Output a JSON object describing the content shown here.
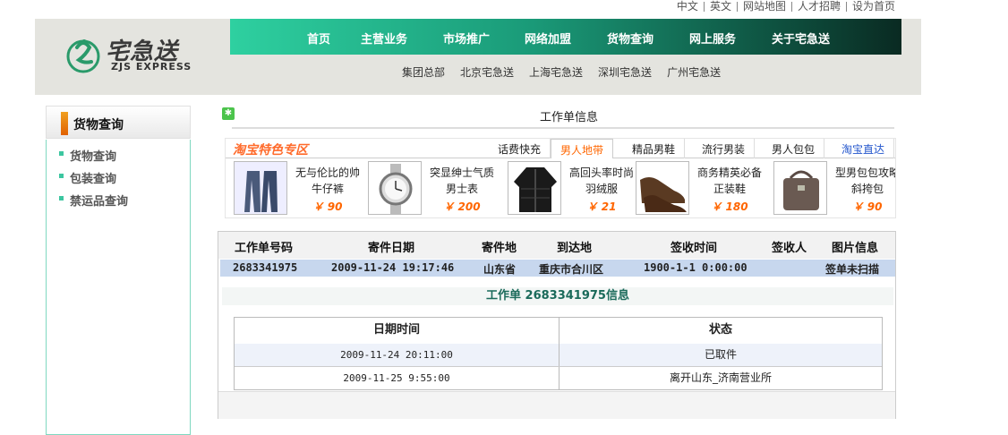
{
  "top_links": [
    "中文",
    "英文",
    "网站地图",
    "人才招聘",
    "设为首页"
  ],
  "logo": {
    "cn": "宅急送",
    "en": "ZJS EXPRESS"
  },
  "nav": [
    "首页",
    "主营业务",
    "市场推广",
    "网络加盟",
    "货物查询",
    "网上服务",
    "关于宅急送"
  ],
  "subnav": [
    "集团总部",
    "北京宅急送",
    "上海宅急送",
    "深圳宅急送",
    "广州宅急送"
  ],
  "sidebar": {
    "title": "货物查询",
    "links": [
      "货物查询",
      "包装查询",
      "禁运品查询"
    ]
  },
  "work_order": {
    "header": "工作单信息"
  },
  "taobao": {
    "title": "淘宝特色专区",
    "tabs": [
      "话费快充",
      "男人地带",
      "精品男鞋",
      "流行男装",
      "男人包包",
      "淘宝直达"
    ],
    "active_tab": "男人地带",
    "products": [
      {
        "name": "无与伦比的帅牛仔裤",
        "price": "￥ 90"
      },
      {
        "name": "突显绅士气质男士表",
        "price": "￥ 200"
      },
      {
        "name": "高回头率时尚羽绒服",
        "price": "￥ 21"
      },
      {
        "name": "商务精英必备正装鞋",
        "price": "￥ 180"
      },
      {
        "name": "型男包包攻略斜挎包",
        "price": "￥ 90"
      }
    ]
  },
  "tracking": {
    "headers": [
      "工作单号码",
      "寄件日期",
      "寄件地",
      "到达地",
      "签收时间",
      "签收人",
      "图片信息"
    ],
    "row": {
      "number": "2683341975",
      "date": "2009-11-24 19:17:46",
      "from": "山东省",
      "to": "重庆市合川区",
      "sign_time": "1900-1-1 0:00:00",
      "signer": "",
      "image_info": "签单未扫描"
    },
    "info_title": "工作单 2683341975信息",
    "detail_headers": [
      "日期时间",
      "状态"
    ],
    "detail_rows": [
      {
        "time": "2009-11-24 20:11:00",
        "status": "已取件"
      },
      {
        "time": "2009-11-25 9:55:00",
        "status": "离开山东_济南营业所"
      }
    ]
  }
}
